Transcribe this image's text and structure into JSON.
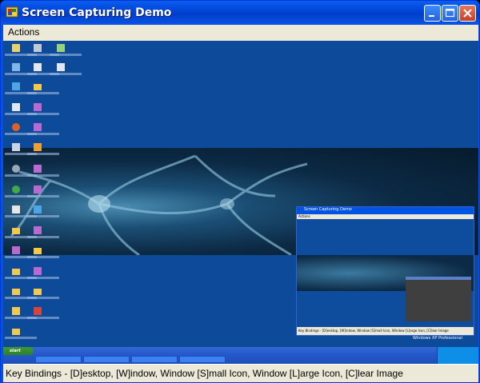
{
  "window": {
    "title": "Screen Capturing Demo"
  },
  "menu": {
    "items": [
      "Actions"
    ]
  },
  "capture": {
    "inner_window_title": "Screen Capturing Demo",
    "inner_menu": "Actions",
    "inner_status": "Key Bindings - [D]esktop, [W]indow, Window [S]mall Icon, Window [L]arge Icon, [C]lear Image",
    "os_watermark_line1": "Windows XP Professional",
    "start_label": "start"
  },
  "statusbar": {
    "text": "Key Bindings - [D]esktop, [W]indow, Window [S]mall Icon, Window [L]arge Icon, [C]lear Image"
  },
  "colors": {
    "title_bar": "#0054e3",
    "menu_bg": "#ece9d8",
    "desktop_blue": "#0d4a9a",
    "close_button": "#c4412b"
  },
  "icons": [
    "app-icon",
    "minimize-icon",
    "maximize-icon",
    "close-icon"
  ]
}
